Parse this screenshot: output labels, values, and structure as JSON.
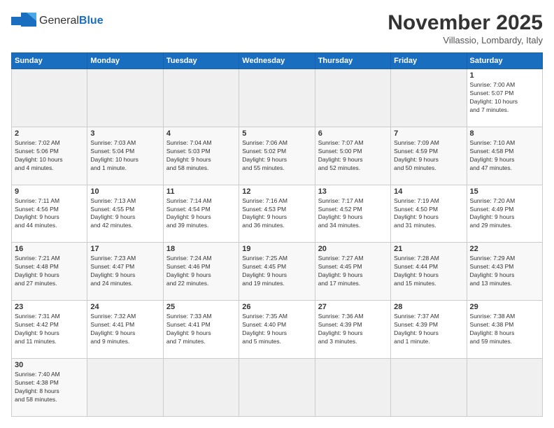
{
  "logo": {
    "text_general": "General",
    "text_blue": "Blue"
  },
  "header": {
    "month": "November 2025",
    "location": "Villassio, Lombardy, Italy"
  },
  "weekdays": [
    "Sunday",
    "Monday",
    "Tuesday",
    "Wednesday",
    "Thursday",
    "Friday",
    "Saturday"
  ],
  "weeks": [
    [
      {
        "day": "",
        "info": ""
      },
      {
        "day": "",
        "info": ""
      },
      {
        "day": "",
        "info": ""
      },
      {
        "day": "",
        "info": ""
      },
      {
        "day": "",
        "info": ""
      },
      {
        "day": "",
        "info": ""
      },
      {
        "day": "1",
        "info": "Sunrise: 7:00 AM\nSunset: 5:07 PM\nDaylight: 10 hours\nand 7 minutes."
      }
    ],
    [
      {
        "day": "2",
        "info": "Sunrise: 7:02 AM\nSunset: 5:06 PM\nDaylight: 10 hours\nand 4 minutes."
      },
      {
        "day": "3",
        "info": "Sunrise: 7:03 AM\nSunset: 5:04 PM\nDaylight: 10 hours\nand 1 minute."
      },
      {
        "day": "4",
        "info": "Sunrise: 7:04 AM\nSunset: 5:03 PM\nDaylight: 9 hours\nand 58 minutes."
      },
      {
        "day": "5",
        "info": "Sunrise: 7:06 AM\nSunset: 5:02 PM\nDaylight: 9 hours\nand 55 minutes."
      },
      {
        "day": "6",
        "info": "Sunrise: 7:07 AM\nSunset: 5:00 PM\nDaylight: 9 hours\nand 52 minutes."
      },
      {
        "day": "7",
        "info": "Sunrise: 7:09 AM\nSunset: 4:59 PM\nDaylight: 9 hours\nand 50 minutes."
      },
      {
        "day": "8",
        "info": "Sunrise: 7:10 AM\nSunset: 4:58 PM\nDaylight: 9 hours\nand 47 minutes."
      }
    ],
    [
      {
        "day": "9",
        "info": "Sunrise: 7:11 AM\nSunset: 4:56 PM\nDaylight: 9 hours\nand 44 minutes."
      },
      {
        "day": "10",
        "info": "Sunrise: 7:13 AM\nSunset: 4:55 PM\nDaylight: 9 hours\nand 42 minutes."
      },
      {
        "day": "11",
        "info": "Sunrise: 7:14 AM\nSunset: 4:54 PM\nDaylight: 9 hours\nand 39 minutes."
      },
      {
        "day": "12",
        "info": "Sunrise: 7:16 AM\nSunset: 4:53 PM\nDaylight: 9 hours\nand 36 minutes."
      },
      {
        "day": "13",
        "info": "Sunrise: 7:17 AM\nSunset: 4:52 PM\nDaylight: 9 hours\nand 34 minutes."
      },
      {
        "day": "14",
        "info": "Sunrise: 7:19 AM\nSunset: 4:50 PM\nDaylight: 9 hours\nand 31 minutes."
      },
      {
        "day": "15",
        "info": "Sunrise: 7:20 AM\nSunset: 4:49 PM\nDaylight: 9 hours\nand 29 minutes."
      }
    ],
    [
      {
        "day": "16",
        "info": "Sunrise: 7:21 AM\nSunset: 4:48 PM\nDaylight: 9 hours\nand 27 minutes."
      },
      {
        "day": "17",
        "info": "Sunrise: 7:23 AM\nSunset: 4:47 PM\nDaylight: 9 hours\nand 24 minutes."
      },
      {
        "day": "18",
        "info": "Sunrise: 7:24 AM\nSunset: 4:46 PM\nDaylight: 9 hours\nand 22 minutes."
      },
      {
        "day": "19",
        "info": "Sunrise: 7:25 AM\nSunset: 4:45 PM\nDaylight: 9 hours\nand 19 minutes."
      },
      {
        "day": "20",
        "info": "Sunrise: 7:27 AM\nSunset: 4:45 PM\nDaylight: 9 hours\nand 17 minutes."
      },
      {
        "day": "21",
        "info": "Sunrise: 7:28 AM\nSunset: 4:44 PM\nDaylight: 9 hours\nand 15 minutes."
      },
      {
        "day": "22",
        "info": "Sunrise: 7:29 AM\nSunset: 4:43 PM\nDaylight: 9 hours\nand 13 minutes."
      }
    ],
    [
      {
        "day": "23",
        "info": "Sunrise: 7:31 AM\nSunset: 4:42 PM\nDaylight: 9 hours\nand 11 minutes."
      },
      {
        "day": "24",
        "info": "Sunrise: 7:32 AM\nSunset: 4:41 PM\nDaylight: 9 hours\nand 9 minutes."
      },
      {
        "day": "25",
        "info": "Sunrise: 7:33 AM\nSunset: 4:41 PM\nDaylight: 9 hours\nand 7 minutes."
      },
      {
        "day": "26",
        "info": "Sunrise: 7:35 AM\nSunset: 4:40 PM\nDaylight: 9 hours\nand 5 minutes."
      },
      {
        "day": "27",
        "info": "Sunrise: 7:36 AM\nSunset: 4:39 PM\nDaylight: 9 hours\nand 3 minutes."
      },
      {
        "day": "28",
        "info": "Sunrise: 7:37 AM\nSunset: 4:39 PM\nDaylight: 9 hours\nand 1 minute."
      },
      {
        "day": "29",
        "info": "Sunrise: 7:38 AM\nSunset: 4:38 PM\nDaylight: 8 hours\nand 59 minutes."
      }
    ],
    [
      {
        "day": "30",
        "info": "Sunrise: 7:40 AM\nSunset: 4:38 PM\nDaylight: 8 hours\nand 58 minutes."
      },
      {
        "day": "",
        "info": ""
      },
      {
        "day": "",
        "info": ""
      },
      {
        "day": "",
        "info": ""
      },
      {
        "day": "",
        "info": ""
      },
      {
        "day": "",
        "info": ""
      },
      {
        "day": "",
        "info": ""
      }
    ]
  ]
}
